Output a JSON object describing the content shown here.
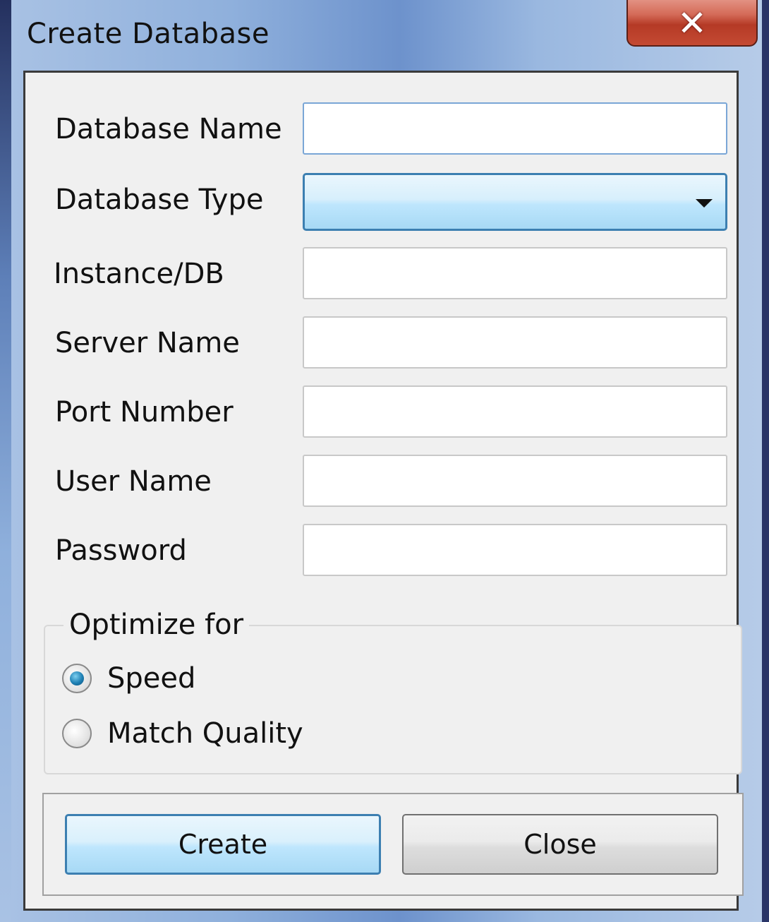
{
  "window": {
    "title": "Create Database",
    "close_glyph": "✕"
  },
  "form": {
    "fields": [
      {
        "label": "Database Name",
        "value": ""
      },
      {
        "label": "Database Type",
        "value": ""
      },
      {
        "label": "Instance/DB",
        "value": ""
      },
      {
        "label": "Server Name",
        "value": ""
      },
      {
        "label": "Port Number",
        "value": ""
      },
      {
        "label": "User Name",
        "value": ""
      },
      {
        "label": "Password",
        "value": ""
      }
    ]
  },
  "optimize": {
    "legend": "Optimize for",
    "options": [
      {
        "label": "Speed",
        "checked": true
      },
      {
        "label": "Match Quality",
        "checked": false
      }
    ]
  },
  "buttons": {
    "create_label": "Create",
    "close_label": "Close"
  },
  "colors": {
    "accent_border": "#3c7fb1",
    "close_red": "#c44a33"
  }
}
